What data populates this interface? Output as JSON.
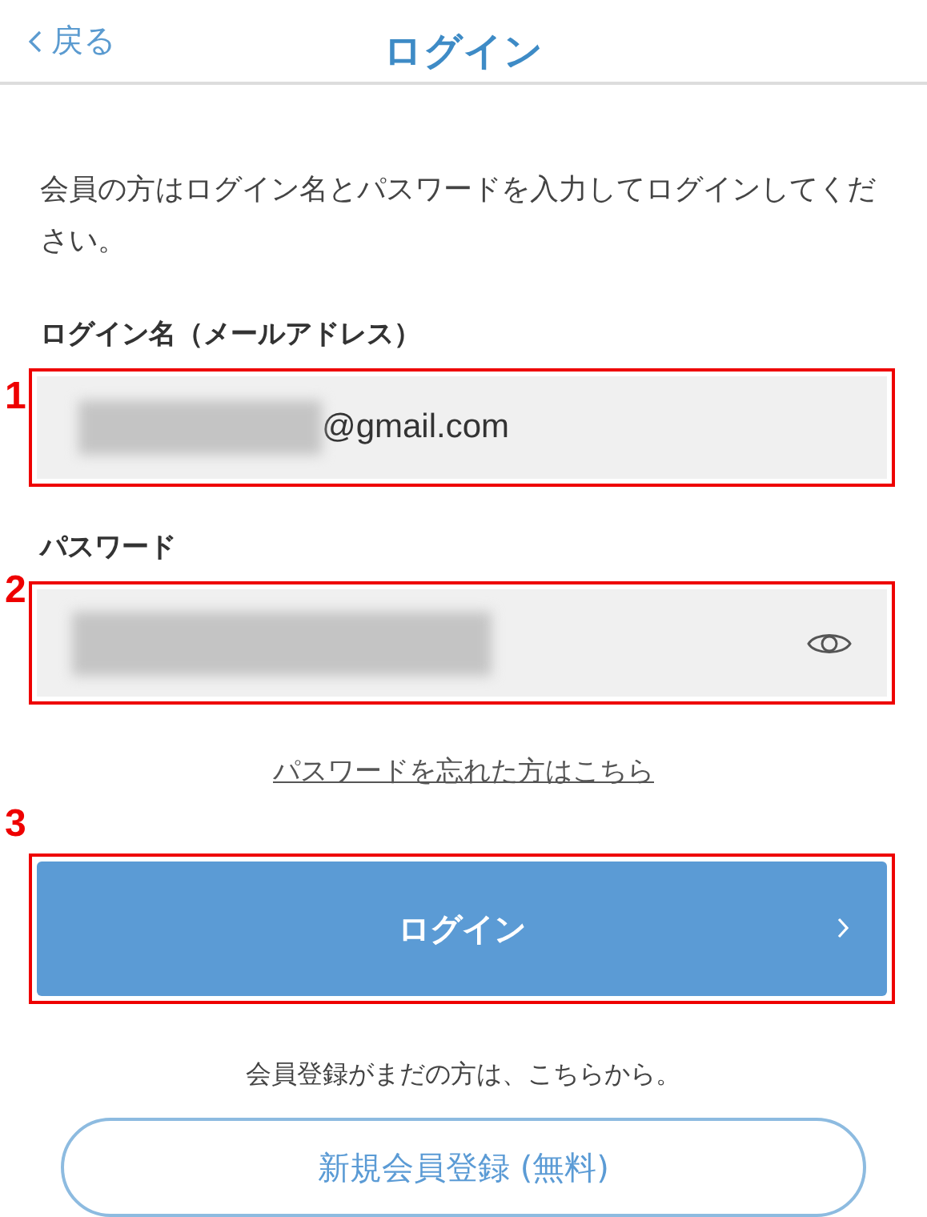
{
  "header": {
    "back": "戻る",
    "title": "ログイン"
  },
  "intro": "会員の方はログイン名とパスワードを入力してログインしてください。",
  "email_field": {
    "label": "ログイン名（メールアドレス）",
    "value": "@gmail.com",
    "annotation": "1"
  },
  "password_field": {
    "label": "パスワード",
    "annotation": "2"
  },
  "forgot_link": "パスワードを忘れた方はこちら",
  "login_button": {
    "label": "ログイン",
    "annotation": "3"
  },
  "register_note": "会員登録がまだの方は、こちらから。",
  "register_button": "新規会員登録 (無料)"
}
